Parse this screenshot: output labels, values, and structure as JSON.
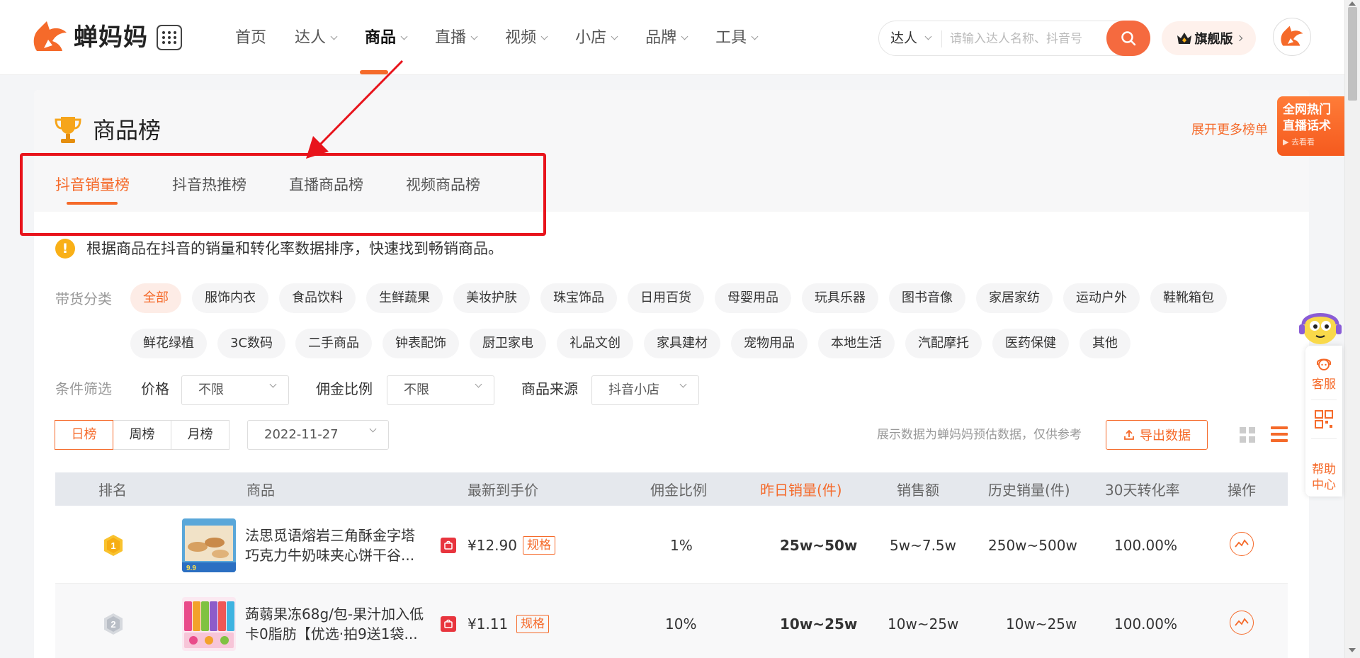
{
  "brand": {
    "name": "蝉妈妈",
    "color": "#f56a2a"
  },
  "nav": {
    "items": [
      {
        "label": "首页",
        "dropdown": false,
        "active": false
      },
      {
        "label": "达人",
        "dropdown": true,
        "active": false
      },
      {
        "label": "商品",
        "dropdown": true,
        "active": true
      },
      {
        "label": "直播",
        "dropdown": true,
        "active": false
      },
      {
        "label": "视频",
        "dropdown": true,
        "active": false
      },
      {
        "label": "小店",
        "dropdown": true,
        "active": false
      },
      {
        "label": "品牌",
        "dropdown": true,
        "active": false
      },
      {
        "label": "工具",
        "dropdown": true,
        "active": false
      }
    ]
  },
  "search": {
    "type": "达人",
    "placeholder": "请输入达人名称、抖音号"
  },
  "flagship": {
    "label": "旗舰版"
  },
  "page": {
    "title": "商品榜",
    "more": "展开更多榜单"
  },
  "tabs": [
    {
      "label": "抖音销量榜",
      "active": true
    },
    {
      "label": "抖音热推榜",
      "active": false
    },
    {
      "label": "直播商品榜",
      "active": false
    },
    {
      "label": "视频商品榜",
      "active": false
    }
  ],
  "notice": "根据商品在抖音的销量和转化率数据排序，快速找到畅销商品。",
  "categories": {
    "label": "带货分类",
    "row1": [
      "全部",
      "服饰内衣",
      "食品饮料",
      "生鲜蔬果",
      "美妆护肤",
      "珠宝饰品",
      "日用百货",
      "母婴用品",
      "玩具乐器",
      "图书音像",
      "家居家纺",
      "运动户外",
      "鞋靴箱包"
    ],
    "row2": [
      "鲜花绿植",
      "3C数码",
      "二手商品",
      "钟表配饰",
      "厨卫家电",
      "礼品文创",
      "家具建材",
      "宠物用品",
      "本地生活",
      "汽配摩托",
      "医药保健",
      "其他"
    ],
    "active": "全部"
  },
  "filters": {
    "label": "条件筛选",
    "price": {
      "label": "价格",
      "value": "不限"
    },
    "commission": {
      "label": "佣金比例",
      "value": "不限"
    },
    "source": {
      "label": "商品来源",
      "value": "抖音小店"
    }
  },
  "period": {
    "options": [
      "日榜",
      "周榜",
      "月榜"
    ],
    "active": "日榜",
    "date": "2022-11-27"
  },
  "disclaimer": "展示数据为蝉妈妈预估数据，仅供参考",
  "export": {
    "label": "导出数据"
  },
  "table": {
    "columns": [
      "排名",
      "商品",
      "最新到手价",
      "佣金比例",
      "昨日销量(件)",
      "销售额",
      "历史销量(件)",
      "30天转化率",
      "操作"
    ],
    "highlight_column": "昨日销量(件)",
    "rows": [
      {
        "rank": "1",
        "name_line1": "法思觅语熔岩三角酥金字塔",
        "name_line2": "巧克力牛奶味夹心饼干谷...",
        "thumb_badge": "9.9",
        "price": "¥12.90",
        "tag": "规格",
        "commission": "1%",
        "yesterday": "25w~50w",
        "sales": "5w~7.5w",
        "history": "250w~500w",
        "conversion": "100.00%"
      },
      {
        "rank": "2",
        "name_line1": "蒟蒻果冻68g/包-果汁加入低",
        "name_line2": "卡0脂肪【优选·拍9送1袋...",
        "thumb_badge": "",
        "price": "¥1.11",
        "tag": "规格",
        "commission": "10%",
        "yesterday": "10w~25w",
        "sales": "10w~25w",
        "history": "10w~25w",
        "conversion": "100.00%"
      }
    ]
  },
  "promo": {
    "line1": "全网热门",
    "line2": "直播话术",
    "line3": "去看看"
  },
  "float": {
    "service": {
      "l1": "客服"
    },
    "help": {
      "l1": "帮助",
      "l2": "中心"
    }
  }
}
